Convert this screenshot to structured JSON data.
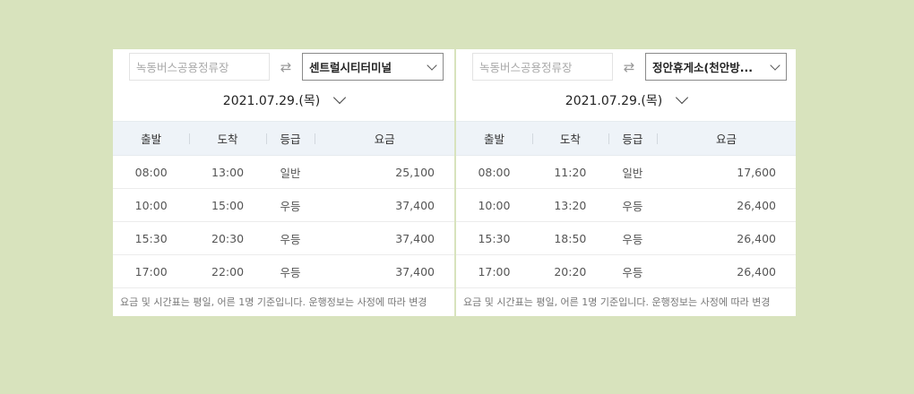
{
  "columns": [
    "출발",
    "도착",
    "등급",
    "요금"
  ],
  "panels": [
    {
      "from_placeholder": "녹동버스공용정류장",
      "to_value": "센트럴시티터미널",
      "date": "2021.07.29.(목)",
      "rows": [
        {
          "dep": "08:00",
          "arr": "13:00",
          "grade": "일반",
          "fare": "25,100"
        },
        {
          "dep": "10:00",
          "arr": "15:00",
          "grade": "우등",
          "fare": "37,400"
        },
        {
          "dep": "15:30",
          "arr": "20:30",
          "grade": "우등",
          "fare": "37,400"
        },
        {
          "dep": "17:00",
          "arr": "22:00",
          "grade": "우등",
          "fare": "37,400"
        }
      ],
      "note": "요금 및 시간표는 평일, 어른 1명 기준입니다. 운행정보는 사정에 따라 변경"
    },
    {
      "from_placeholder": "녹동버스공용정류장",
      "to_value": "정안휴게소(천안방...",
      "date": "2021.07.29.(목)",
      "rows": [
        {
          "dep": "08:00",
          "arr": "11:20",
          "grade": "일반",
          "fare": "17,600"
        },
        {
          "dep": "10:00",
          "arr": "13:20",
          "grade": "우등",
          "fare": "26,400"
        },
        {
          "dep": "15:30",
          "arr": "18:50",
          "grade": "우등",
          "fare": "26,400"
        },
        {
          "dep": "17:00",
          "arr": "20:20",
          "grade": "우등",
          "fare": "26,400"
        }
      ],
      "note": "요금 및 시간표는 평일, 어른 1명 기준입니다. 운행정보는 사정에 따라 변경"
    }
  ],
  "icons": {
    "swap": "swap-arrows-icon",
    "dropdown": "chevron-down-icon"
  }
}
